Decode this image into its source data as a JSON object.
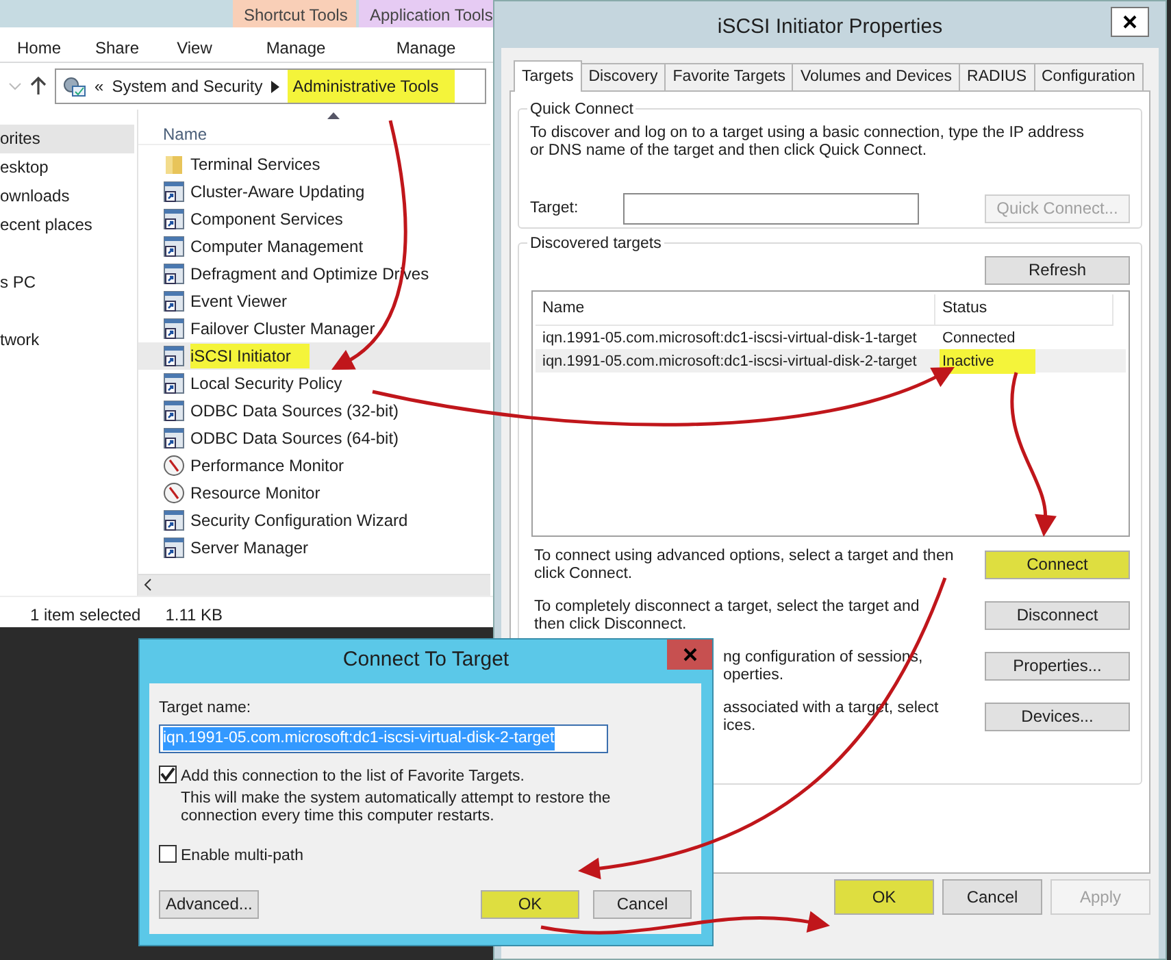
{
  "explorer": {
    "contextual_tabs": [
      {
        "label": "Shortcut Tools",
        "color": "#f9cfb7"
      },
      {
        "label": "Application Tools",
        "color": "#e6cbf3"
      }
    ],
    "ribbon_tabs": [
      "Home",
      "Share",
      "View",
      "Manage",
      "Manage"
    ],
    "address": {
      "overflow": "«",
      "segments": [
        {
          "label": "System and Security",
          "highlighted": false
        },
        {
          "label": "Administrative Tools",
          "highlighted": true
        }
      ]
    },
    "nav_groups": [
      [
        {
          "label": "orites",
          "selected": true
        },
        {
          "label": "esktop",
          "selected": false
        },
        {
          "label": "ownloads",
          "selected": false
        },
        {
          "label": "ecent places",
          "selected": false
        }
      ],
      [
        {
          "label": "s PC",
          "selected": false
        }
      ],
      [
        {
          "label": "twork",
          "selected": false
        }
      ]
    ],
    "column_header": "Name",
    "files": [
      {
        "label": "Terminal Services",
        "kind": "folder",
        "selected": false
      },
      {
        "label": "Cluster-Aware Updating",
        "kind": "tool",
        "selected": false
      },
      {
        "label": "Component Services",
        "kind": "tool",
        "selected": false
      },
      {
        "label": "Computer Management",
        "kind": "tool",
        "selected": false
      },
      {
        "label": "Defragment and Optimize Drives",
        "kind": "tool",
        "selected": false
      },
      {
        "label": "Event Viewer",
        "kind": "tool",
        "selected": false
      },
      {
        "label": "Failover Cluster Manager",
        "kind": "tool",
        "selected": false
      },
      {
        "label": "iSCSI Initiator",
        "kind": "tool",
        "selected": true
      },
      {
        "label": "Local Security Policy",
        "kind": "tool",
        "selected": false
      },
      {
        "label": "ODBC Data Sources (32-bit)",
        "kind": "tool",
        "selected": false
      },
      {
        "label": "ODBC Data Sources (64-bit)",
        "kind": "tool",
        "selected": false
      },
      {
        "label": "Performance Monitor",
        "kind": "gauge",
        "selected": false
      },
      {
        "label": "Resource Monitor",
        "kind": "gauge",
        "selected": false
      },
      {
        "label": "Security Configuration Wizard",
        "kind": "tool",
        "selected": false
      },
      {
        "label": "Server Manager",
        "kind": "tool",
        "selected": false
      }
    ],
    "status_bar": [
      "1 item selected",
      "1.11 KB"
    ]
  },
  "iscsi": {
    "title": "iSCSI Initiator Properties",
    "tabs": [
      {
        "label": "Targets",
        "selected": true
      },
      {
        "label": "Discovery",
        "selected": false
      },
      {
        "label": "Favorite Targets",
        "selected": false
      },
      {
        "label": "Volumes and Devices",
        "selected": false
      },
      {
        "label": "RADIUS",
        "selected": false
      },
      {
        "label": "Configuration",
        "selected": false
      }
    ],
    "quick_connect": {
      "legend": "Quick Connect",
      "text": "To discover and log on to a target using a basic connection, type the IP address or DNS name of the target and then click Quick Connect.",
      "target_label": "Target:",
      "button": {
        "label": "Quick Connect...",
        "disabled": true
      }
    },
    "discovered": {
      "legend": "Discovered targets",
      "refresh": "Refresh",
      "columns": [
        "Name",
        "Status"
      ],
      "rows": [
        {
          "name": "iqn.1991-05.com.microsoft:dc1-iscsi-virtual-disk-1-target",
          "status": "Connected",
          "selected": false,
          "highlighted": false
        },
        {
          "name": "iqn.1991-05.com.microsoft:dc1-iscsi-virtual-disk-2-target",
          "status": "Inactive",
          "selected": true,
          "highlighted": true
        }
      ]
    },
    "actions": [
      {
        "lines": [
          "To connect using advanced options, select a target and then",
          "click Connect."
        ],
        "button": "Connect",
        "highlighted": true
      },
      {
        "lines": [
          "To completely disconnect a target, select the target and",
          "then click Disconnect."
        ],
        "button": "Disconnect",
        "highlighted": false
      },
      {
        "lines": [
          "ng configuration of sessions,",
          "operties."
        ],
        "button": "Properties...",
        "highlighted": false
      },
      {
        "lines": [
          "associated with a target, select",
          "ices."
        ],
        "button": "Devices...",
        "highlighted": false
      }
    ],
    "footer": [
      {
        "label": "OK",
        "disabled": false,
        "highlighted": true
      },
      {
        "label": "Cancel",
        "disabled": false,
        "highlighted": false
      },
      {
        "label": "Apply",
        "disabled": true,
        "highlighted": false
      }
    ]
  },
  "connect": {
    "title": "Connect To Target",
    "target_label": "Target name:",
    "target_value": "iqn.1991-05.com.microsoft:dc1-iscsi-virtual-disk-2-target",
    "options": [
      {
        "label": "Add this connection to the list of Favorite Targets.",
        "note": [
          "This will make the system automatically attempt to restore the",
          "connection every time this computer restarts."
        ],
        "checked": true
      },
      {
        "label": "Enable multi-path",
        "checked": false
      }
    ],
    "buttons": [
      {
        "label": "Advanced...",
        "highlighted": false
      },
      {
        "label": "OK",
        "highlighted": true
      },
      {
        "label": "Cancel",
        "highlighted": false
      }
    ]
  }
}
